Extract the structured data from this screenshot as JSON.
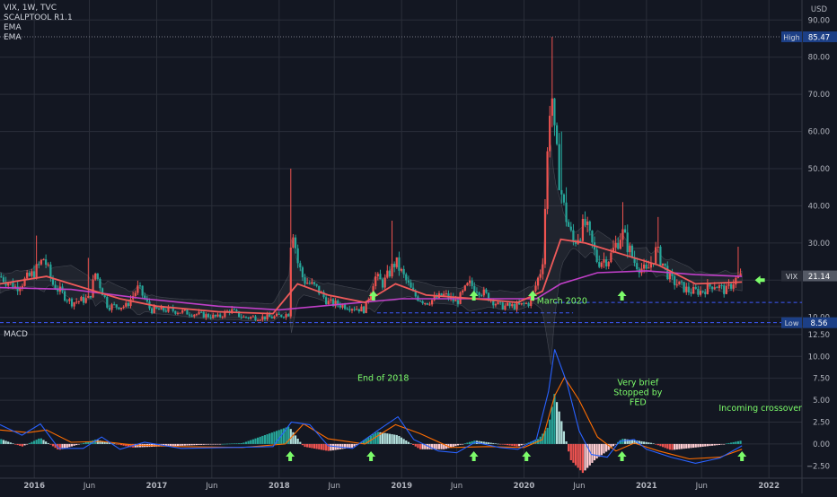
{
  "header": {
    "symbol_line": "VIX, 1W, TVC",
    "currency": "USD",
    "indicators": [
      "SCALPTOOL R1.1",
      "EMA",
      "EMA"
    ]
  },
  "macd_title": "MACD",
  "colors": {
    "background": "#131722",
    "grid": "#2a2e39",
    "text": "#b2b5be",
    "up": "#26a69a",
    "down": "#ef5350",
    "ema_fast": "#f05a5a",
    "ema_slow": "#c03fc8",
    "macd_line": "#2962ff",
    "signal_line": "#ff6d00",
    "annotation": "#7cfc6a",
    "dashed_level": "#3d5afe"
  },
  "chart_data": [
    {
      "type": "candlestick",
      "title": "VIX, 1W, TVC",
      "ylabel": "USD",
      "ylim": [
        8,
        92
      ],
      "y_ticks": [
        10,
        20,
        30,
        40,
        50,
        60,
        70,
        80,
        90
      ],
      "y_tick_labels": [
        "10.00",
        "20.00",
        "30.00",
        "40.00",
        "50.00",
        "60.00",
        "70.00",
        "80.00",
        "90.00"
      ],
      "x_ticks": [
        {
          "t": 2016.0,
          "label": "2016"
        },
        {
          "t": 2016.45,
          "label": "Jun"
        },
        {
          "t": 2017.0,
          "label": "2017"
        },
        {
          "t": 2017.45,
          "label": "Jun"
        },
        {
          "t": 2018.0,
          "label": "2018"
        },
        {
          "t": 2018.45,
          "label": "Jun"
        },
        {
          "t": 2019.0,
          "label": "2019"
        },
        {
          "t": 2019.45,
          "label": "Jun"
        },
        {
          "t": 2020.0,
          "label": "2020"
        },
        {
          "t": 2020.45,
          "label": "Jun"
        },
        {
          "t": 2021.0,
          "label": "2021"
        },
        {
          "t": 2021.45,
          "label": "Jun"
        },
        {
          "t": 2022.0,
          "label": "2022"
        }
      ],
      "xlim": [
        2015.72,
        2022.27
      ],
      "price_labels": [
        {
          "tag": "High",
          "value": 85.47,
          "text": "85.47"
        },
        {
          "tag": "VIX",
          "value": 21.14,
          "text": "21.14"
        },
        {
          "tag": "Low",
          "value": 8.56,
          "text": "8.56"
        }
      ],
      "reference_levels": [
        {
          "value": 85.47,
          "style": "dotted"
        },
        {
          "value": 8.56,
          "style": "dashed-blue"
        },
        {
          "value": 14.0,
          "style": "dashed-blue",
          "from": 2020.25
        },
        {
          "value": 11.2,
          "style": "dashed-blue",
          "from": 2018.8,
          "to": 2020.4
        }
      ],
      "close_path": [
        [
          2015.72,
          21
        ],
        [
          2015.85,
          18
        ],
        [
          2016.0,
          22
        ],
        [
          2016.08,
          26
        ],
        [
          2016.15,
          19
        ],
        [
          2016.3,
          14
        ],
        [
          2016.45,
          15
        ],
        [
          2016.5,
          22
        ],
        [
          2016.6,
          13
        ],
        [
          2016.75,
          13
        ],
        [
          2016.85,
          18
        ],
        [
          2016.95,
          12
        ],
        [
          2017.1,
          12
        ],
        [
          2017.3,
          11
        ],
        [
          2017.5,
          10
        ],
        [
          2017.6,
          12
        ],
        [
          2017.7,
          10
        ],
        [
          2017.85,
          10
        ],
        [
          2017.95,
          10
        ],
        [
          2018.08,
          11
        ],
        [
          2018.1,
          37
        ],
        [
          2018.15,
          25
        ],
        [
          2018.2,
          20
        ],
        [
          2018.3,
          18
        ],
        [
          2018.4,
          14
        ],
        [
          2018.55,
          13
        ],
        [
          2018.7,
          12
        ],
        [
          2018.78,
          21
        ],
        [
          2018.85,
          19
        ],
        [
          2018.95,
          25
        ],
        [
          2019.0,
          22
        ],
        [
          2019.1,
          16
        ],
        [
          2019.2,
          14
        ],
        [
          2019.35,
          16
        ],
        [
          2019.45,
          14
        ],
        [
          2019.55,
          19
        ],
        [
          2019.65,
          17
        ],
        [
          2019.8,
          13
        ],
        [
          2019.95,
          13
        ],
        [
          2020.05,
          14
        ],
        [
          2020.1,
          19
        ],
        [
          2020.15,
          24
        ],
        [
          2020.2,
          60
        ],
        [
          2020.22,
          75
        ],
        [
          2020.25,
          57
        ],
        [
          2020.32,
          40
        ],
        [
          2020.4,
          30
        ],
        [
          2020.5,
          35
        ],
        [
          2020.6,
          25
        ],
        [
          2020.7,
          26
        ],
        [
          2020.8,
          33
        ],
        [
          2020.9,
          25
        ],
        [
          2021.0,
          22
        ],
        [
          2021.08,
          28
        ],
        [
          2021.2,
          20
        ],
        [
          2021.35,
          17
        ],
        [
          2021.45,
          17
        ],
        [
          2021.55,
          19
        ],
        [
          2021.65,
          17
        ],
        [
          2021.72,
          20
        ],
        [
          2021.78,
          21.14
        ]
      ],
      "wick_spikes": [
        {
          "t": 2016.02,
          "high": 32
        },
        {
          "t": 2016.45,
          "high": 26
        },
        {
          "t": 2018.1,
          "high": 50
        },
        {
          "t": 2018.93,
          "high": 36
        },
        {
          "t": 2020.22,
          "high": 85.47
        },
        {
          "t": 2020.3,
          "high": 60
        },
        {
          "t": 2020.35,
          "high": 45
        },
        {
          "t": 2020.8,
          "high": 41
        },
        {
          "t": 2021.1,
          "high": 37
        },
        {
          "t": 2021.75,
          "high": 29
        }
      ],
      "ema_fast_path": [
        [
          2015.72,
          19
        ],
        [
          2016.1,
          21
        ],
        [
          2016.4,
          18
        ],
        [
          2016.7,
          15
        ],
        [
          2017.0,
          13
        ],
        [
          2017.5,
          11.5
        ],
        [
          2017.95,
          11
        ],
        [
          2018.15,
          19
        ],
        [
          2018.4,
          16
        ],
        [
          2018.7,
          14
        ],
        [
          2018.95,
          19
        ],
        [
          2019.2,
          16
        ],
        [
          2019.6,
          15
        ],
        [
          2019.95,
          14
        ],
        [
          2020.15,
          17
        ],
        [
          2020.3,
          31
        ],
        [
          2020.5,
          30
        ],
        [
          2020.8,
          27
        ],
        [
          2021.1,
          24
        ],
        [
          2021.4,
          19
        ],
        [
          2021.78,
          19.5
        ]
      ],
      "ema_slow_path": [
        [
          2015.72,
          18
        ],
        [
          2016.3,
          17.5
        ],
        [
          2016.9,
          15
        ],
        [
          2017.5,
          13
        ],
        [
          2018.0,
          12
        ],
        [
          2018.5,
          13.5
        ],
        [
          2019.0,
          15
        ],
        [
          2019.6,
          15
        ],
        [
          2020.1,
          15
        ],
        [
          2020.3,
          19
        ],
        [
          2020.6,
          22
        ],
        [
          2021.0,
          22.5
        ],
        [
          2021.4,
          21.5
        ],
        [
          2021.78,
          21
        ]
      ],
      "arrows": [
        {
          "t": 2018.77,
          "label": ""
        },
        {
          "t": 2019.59,
          "label": ""
        },
        {
          "t": 2020.07,
          "label": ""
        },
        {
          "t": 2020.8,
          "label": ""
        }
      ],
      "current_arrow": {
        "t": 2021.93,
        "value": 20
      }
    },
    {
      "type": "macd",
      "title": "MACD",
      "ylim": [
        -3.9,
        13.2
      ],
      "y_ticks": [
        -2.5,
        0,
        2.5,
        5,
        7.5,
        10,
        12.5
      ],
      "y_tick_labels": [
        "−2.50",
        "0.00",
        "2.50",
        "5.00",
        "7.50",
        "10.00",
        "12.50"
      ],
      "macd_path": [
        [
          2015.72,
          2.2
        ],
        [
          2015.9,
          1
        ],
        [
          2016.05,
          2.3
        ],
        [
          2016.2,
          -0.5
        ],
        [
          2016.4,
          -0.5
        ],
        [
          2016.55,
          0.8
        ],
        [
          2016.7,
          -0.6
        ],
        [
          2016.9,
          0.2
        ],
        [
          2017.2,
          -0.5
        ],
        [
          2017.6,
          -0.4
        ],
        [
          2017.95,
          -0.3
        ],
        [
          2018.1,
          2.5
        ],
        [
          2018.25,
          2.2
        ],
        [
          2018.4,
          -0.2
        ],
        [
          2018.6,
          -0.5
        ],
        [
          2018.8,
          1.5
        ],
        [
          2018.97,
          3.1
        ],
        [
          2019.1,
          0.5
        ],
        [
          2019.3,
          -0.8
        ],
        [
          2019.45,
          -1.0
        ],
        [
          2019.6,
          0.2
        ],
        [
          2019.8,
          -0.4
        ],
        [
          2019.95,
          -0.6
        ],
        [
          2020.1,
          0.5
        ],
        [
          2020.2,
          6
        ],
        [
          2020.25,
          10.8
        ],
        [
          2020.35,
          7
        ],
        [
          2020.45,
          1.5
        ],
        [
          2020.55,
          -1.2
        ],
        [
          2020.68,
          -1.5
        ],
        [
          2020.78,
          0.3
        ],
        [
          2020.9,
          0.5
        ],
        [
          2021.0,
          -0.6
        ],
        [
          2021.2,
          -1.5
        ],
        [
          2021.4,
          -2.2
        ],
        [
          2021.6,
          -1.6
        ],
        [
          2021.78,
          -0.2
        ]
      ],
      "signal_path": [
        [
          2015.72,
          1.6
        ],
        [
          2015.95,
          1.3
        ],
        [
          2016.1,
          1.6
        ],
        [
          2016.3,
          0.2
        ],
        [
          2016.55,
          0.3
        ],
        [
          2016.8,
          -0.1
        ],
        [
          2017.2,
          -0.3
        ],
        [
          2017.7,
          -0.4
        ],
        [
          2018.05,
          0.0
        ],
        [
          2018.2,
          2.3
        ],
        [
          2018.4,
          0.6
        ],
        [
          2018.7,
          0.0
        ],
        [
          2018.95,
          2.2
        ],
        [
          2019.15,
          1.2
        ],
        [
          2019.4,
          -0.4
        ],
        [
          2019.7,
          -0.3
        ],
        [
          2020.0,
          -0.4
        ],
        [
          2020.15,
          0.5
        ],
        [
          2020.25,
          5.5
        ],
        [
          2020.33,
          7.6
        ],
        [
          2020.45,
          5
        ],
        [
          2020.6,
          0.8
        ],
        [
          2020.75,
          -0.8
        ],
        [
          2020.9,
          0.1
        ],
        [
          2021.1,
          -0.8
        ],
        [
          2021.35,
          -1.7
        ],
        [
          2021.6,
          -1.5
        ],
        [
          2021.78,
          -0.6
        ]
      ],
      "histogram_path": [
        [
          2015.72,
          0.6
        ],
        [
          2015.9,
          -0.3
        ],
        [
          2016.05,
          0.7
        ],
        [
          2016.2,
          -0.7
        ],
        [
          2016.5,
          0.5
        ],
        [
          2016.8,
          -0.4
        ],
        [
          2017.2,
          -0.2
        ],
        [
          2017.7,
          0.1
        ],
        [
          2018.08,
          2.0
        ],
        [
          2018.2,
          -0.3
        ],
        [
          2018.4,
          -0.8
        ],
        [
          2018.6,
          -0.4
        ],
        [
          2018.8,
          1.4
        ],
        [
          2018.97,
          1.0
        ],
        [
          2019.15,
          -0.6
        ],
        [
          2019.35,
          -0.6
        ],
        [
          2019.6,
          0.4
        ],
        [
          2019.95,
          -0.3
        ],
        [
          2020.12,
          0.6
        ],
        [
          2020.2,
          2
        ],
        [
          2020.25,
          5.8
        ],
        [
          2020.3,
          3
        ],
        [
          2020.38,
          -1.8
        ],
        [
          2020.48,
          -3.3
        ],
        [
          2020.58,
          -1.8
        ],
        [
          2020.7,
          -0.6
        ],
        [
          2020.8,
          0.6
        ],
        [
          2020.92,
          0.4
        ],
        [
          2021.05,
          0.1
        ],
        [
          2021.2,
          -0.7
        ],
        [
          2021.4,
          -0.4
        ],
        [
          2021.6,
          -0.1
        ],
        [
          2021.78,
          0.4
        ]
      ],
      "annotations": [
        {
          "t": 2018.85,
          "value": 7.2,
          "lines": [
            "End of 2018"
          ]
        },
        {
          "t": 2020.31,
          "value": 16.0,
          "lines": [
            "March 2020"
          ]
        },
        {
          "t": 2020.93,
          "value": 6.7,
          "lines": [
            "Very brief",
            "Stopped by",
            "FED"
          ]
        },
        {
          "t": 2021.93,
          "value": 3.8,
          "lines": [
            "Incoming crossover"
          ]
        }
      ],
      "arrows": [
        {
          "t": 2018.09
        },
        {
          "t": 2018.75
        },
        {
          "t": 2019.59
        },
        {
          "t": 2020.02
        },
        {
          "t": 2020.8
        },
        {
          "t": 2021.78
        }
      ]
    }
  ]
}
